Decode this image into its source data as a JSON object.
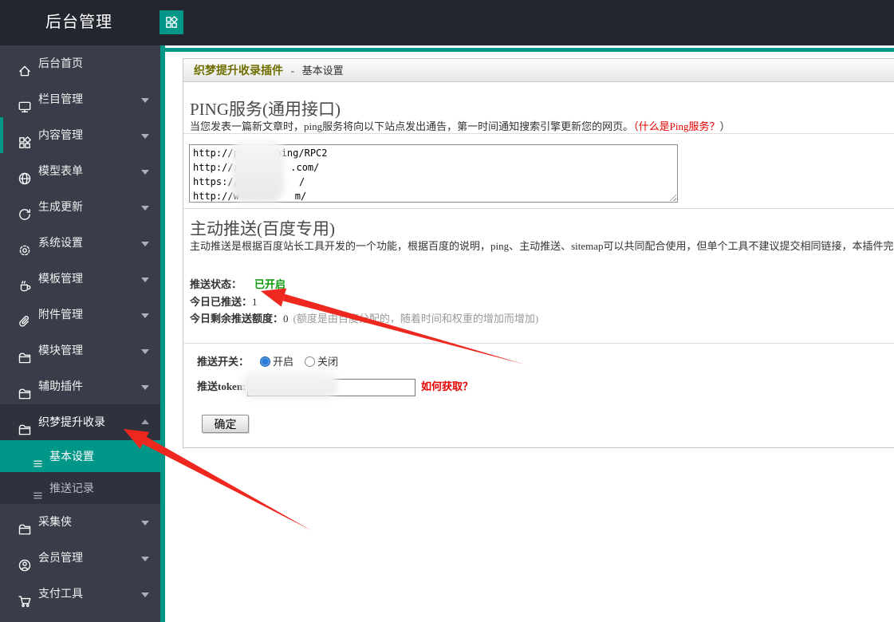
{
  "colors": {
    "accent": "#009688",
    "topbar_bg": "#23262e",
    "sidebar_bg": "#393d49",
    "submenu_bg": "#2e323d",
    "title_olive": "#6e6e00",
    "status_green": "#0a9a0a",
    "red_text": "#e60000",
    "arrow_red": "#ee281e"
  },
  "topbar": {
    "title": "后台管理",
    "logo_icon": "grid-icon"
  },
  "sidebar": {
    "items": [
      {
        "name": "backend-home",
        "label": "后台首页",
        "icon": "home"
      },
      {
        "name": "column-manage",
        "label": "栏目管理",
        "icon": "monitor",
        "caret": "down"
      },
      {
        "name": "content-manage",
        "label": "内容管理",
        "icon": "grid",
        "caret": "down",
        "accent_bar": true
      },
      {
        "name": "model-form",
        "label": "模型表单",
        "icon": "globe",
        "caret": "down"
      },
      {
        "name": "generate-update",
        "label": "生成更新",
        "icon": "refresh",
        "caret": "down"
      },
      {
        "name": "system-settings",
        "label": "系统设置",
        "icon": "gear",
        "caret": "down"
      },
      {
        "name": "template-manage",
        "label": "模板管理",
        "icon": "cup",
        "caret": "down"
      },
      {
        "name": "attachment-manage",
        "label": "附件管理",
        "icon": "clip",
        "caret": "down"
      },
      {
        "name": "module-manage",
        "label": "模块管理",
        "icon": "folder",
        "caret": "down"
      },
      {
        "name": "helper-plugins",
        "label": "辅助插件",
        "icon": "folder",
        "caret": "down"
      },
      {
        "name": "dedecms-seo-plugin",
        "label": "织梦提升收录",
        "icon": "folder",
        "caret": "up",
        "expanded": true,
        "children": [
          {
            "name": "basic-settings",
            "label": "基本设置",
            "icon": "list",
            "active": true
          },
          {
            "name": "push-records",
            "label": "推送记录",
            "icon": "list"
          }
        ]
      },
      {
        "name": "collector",
        "label": "采集侠",
        "icon": "folder",
        "caret": "down"
      },
      {
        "name": "member-manage",
        "label": "会员管理",
        "icon": "user",
        "caret": "down"
      },
      {
        "name": "payment-tools",
        "label": "支付工具",
        "icon": "cart",
        "caret": "down"
      }
    ]
  },
  "content": {
    "header": {
      "plugin": "织梦提升收录插件",
      "sep": "-",
      "page": "基本设置"
    },
    "ping": {
      "title": "PING服务(通用接口)",
      "desc": "当您发表一篇新文章时，ping服务将向以下站点发出通告，第一时间通知搜索引擎更新您的网页。",
      "help_link": "（什么是Ping服务？",
      "help_close": "）",
      "urls": [
        {
          "prefix": "http://ping",
          "suffix": "ping/RPC2"
        },
        {
          "prefix": "http://rpc",
          "suffix": ".com/"
        },
        {
          "prefix": "https://w",
          "suffix": "/"
        },
        {
          "prefix": "http://w",
          "suffix": "m/"
        }
      ]
    },
    "push": {
      "title": "主动推送(百度专用)",
      "desc": "主动推送是根据百度站长工具开发的一个功能，根据百度的说明，ping、主动推送、sitemap可以共同配合使用，但单个工具不建议提交相同链接，本插件完全根据百度的",
      "status_label": "推送状态：",
      "status_value": "已开启",
      "today_label": "今日已推送：",
      "today_value": "1",
      "quota_label": "今日剩余推送额度：",
      "quota_value": "0",
      "quota_note": "(额度是由百度分配的，随着时间和权重的增加而增加)",
      "switch_label": "推送开关：",
      "radio_on": "开启",
      "radio_off": "关闭",
      "token_label": "推送token:",
      "token_value": "",
      "token_help": "如何获取？",
      "submit": "确定"
    }
  }
}
